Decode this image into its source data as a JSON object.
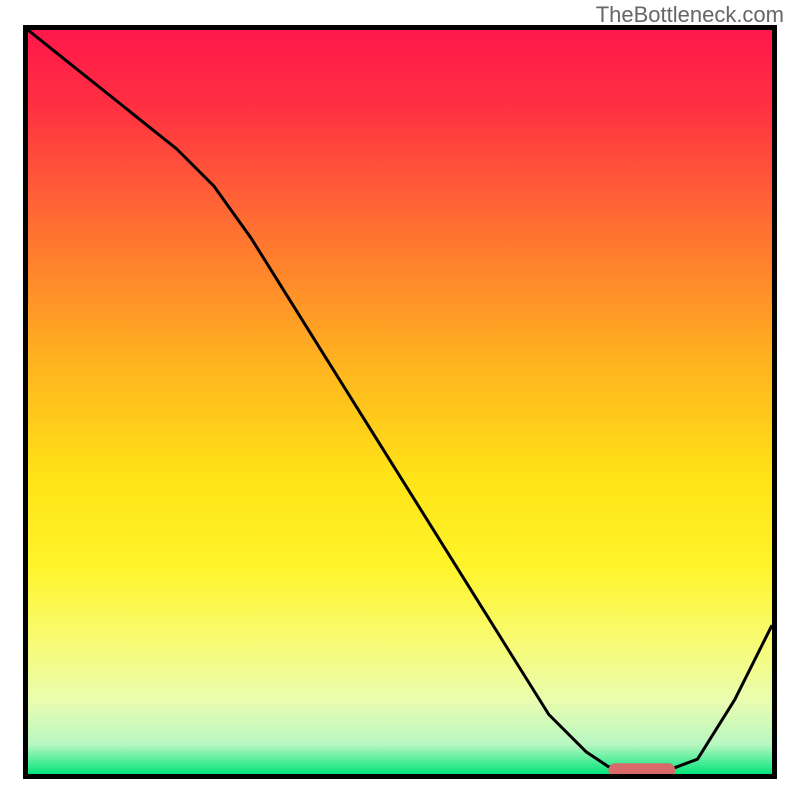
{
  "watermark": "TheBottleneck.com",
  "chart_data": {
    "type": "line",
    "title": "",
    "xlabel": "",
    "ylabel": "",
    "xlim": [
      0,
      100
    ],
    "ylim": [
      0,
      100
    ],
    "grid": false,
    "series": [
      {
        "name": "bottleneck-curve",
        "x": [
          0,
          5,
          10,
          15,
          20,
          25,
          30,
          35,
          40,
          45,
          50,
          55,
          60,
          65,
          70,
          75,
          78,
          82,
          86,
          90,
          95,
          100
        ],
        "y": [
          100,
          96,
          92,
          88,
          84,
          79,
          72,
          64,
          56,
          48,
          40,
          32,
          24,
          16,
          8,
          3,
          1,
          0.5,
          0.5,
          2,
          10,
          20
        ]
      }
    ],
    "marker": {
      "name": "optimal-marker",
      "x_start": 78,
      "x_end": 87,
      "y": 0.5,
      "color": "#d86a6a"
    },
    "gradient_stops": [
      {
        "offset": 0.0,
        "color": "#ff184b"
      },
      {
        "offset": 0.1,
        "color": "#ff2f42"
      },
      {
        "offset": 0.25,
        "color": "#ff6a33"
      },
      {
        "offset": 0.45,
        "color": "#ffb41f"
      },
      {
        "offset": 0.6,
        "color": "#ffe317"
      },
      {
        "offset": 0.72,
        "color": "#fff42a"
      },
      {
        "offset": 0.82,
        "color": "#f8fb72"
      },
      {
        "offset": 0.9,
        "color": "#eafdae"
      },
      {
        "offset": 0.96,
        "color": "#b9f7c2"
      },
      {
        "offset": 1.0,
        "color": "#02e57b"
      }
    ]
  }
}
